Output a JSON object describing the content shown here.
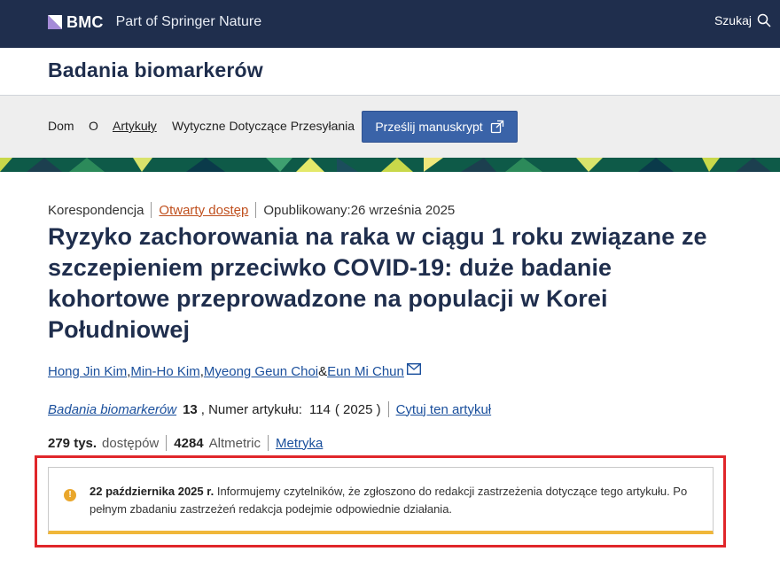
{
  "header": {
    "brand": "BMC",
    "part_of": "Part of Springer Nature",
    "search_label": "Szukaj",
    "bg_color": "#1f2e4d"
  },
  "journal": {
    "title": "Badania biomarkerów"
  },
  "nav": {
    "items": [
      "Dom",
      "O",
      "Artykuły",
      "Wytyczne Dotyczące Przesyłania"
    ],
    "submit_label": "Prześlij manuskrypt",
    "submit_color": "#3a63a8"
  },
  "article": {
    "type": "Korespondencja",
    "access": "Otwarty dostęp",
    "published_label": "Opublikowany:",
    "published_date": "26 września 2025",
    "title": "Ryzyko zachorowania na raka w ciągu 1 roku związane ze szczepieniem przeciwko COVID-19: duże badanie kohortowe przeprowadzone na populacji w Korei Południowej",
    "authors": [
      "Hong Jin Kim",
      "Min-Ho Kim",
      "Myeong Geun Choi",
      "Eun Mi Chun"
    ],
    "author_separators": [
      " ,",
      " ,",
      " &"
    ],
    "journal_name": "Badania biomarkerów",
    "volume": "13",
    "article_number_label": ", Numer artykułu:",
    "article_number": "114",
    "year": "( 2025 )",
    "cite_label": "Cytuj ten artykuł",
    "accesses_value": "279 tys.",
    "accesses_label": "dostępów",
    "altmetric_value": "4284",
    "altmetric_label": "Altmetric",
    "metrics_label": "Metryka"
  },
  "notice": {
    "date": "22 października 2025 r.",
    "text": "Informujemy czytelników, że zgłoszono do redakcji zastrzeżenia dotyczące tego artykułu. Po pełnym zbadaniu zastrzeżeń redakcja podejmie odpowiednie działania.",
    "icon": "info-icon",
    "accent_color": "#f0b73a",
    "highlight_color": "#e0262a"
  }
}
